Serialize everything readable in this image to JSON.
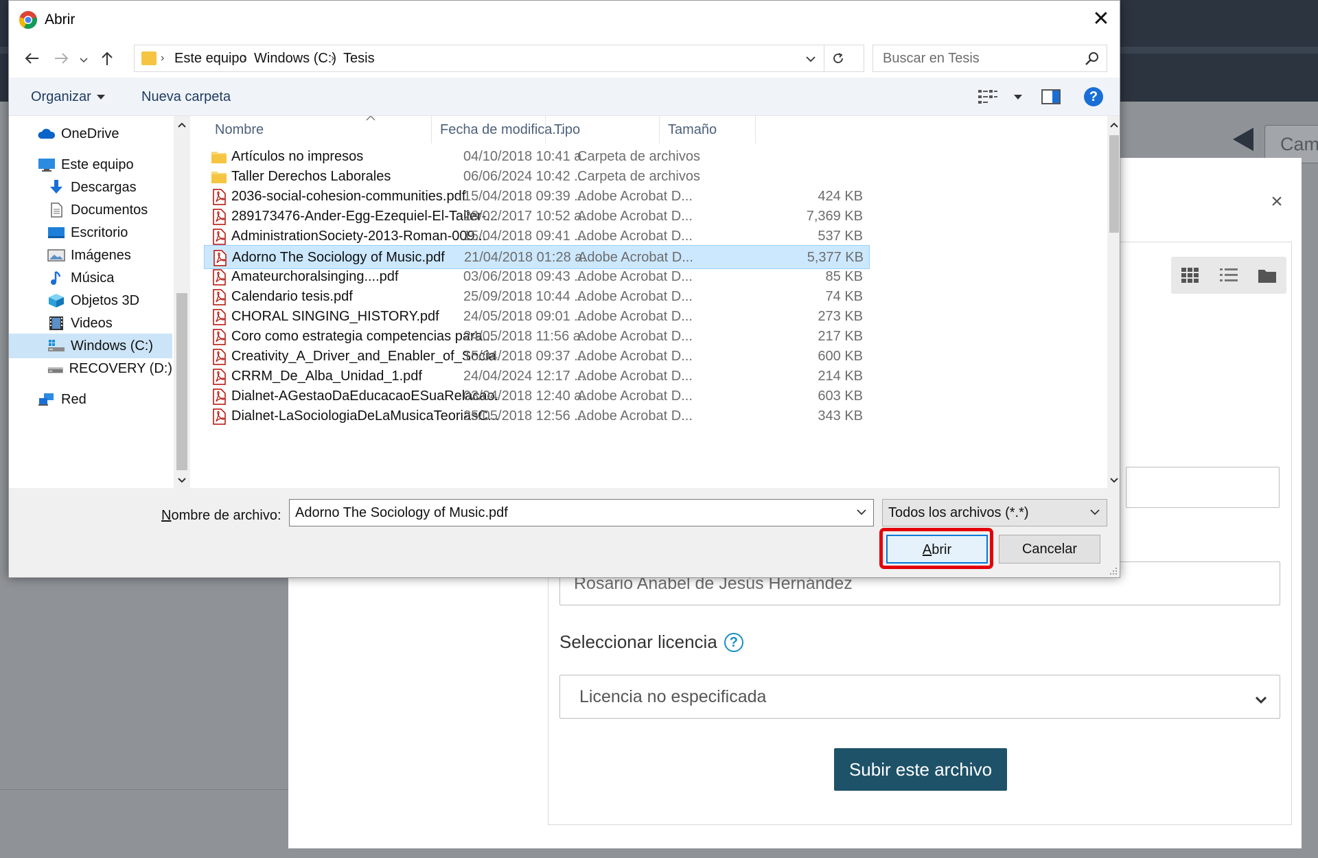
{
  "background": {
    "cam_button": "Cam",
    "close_symbol": "×",
    "author_value": "Rosario Anabel de Jesús Hernández",
    "license_label": "Seleccionar licencia",
    "license_value": "Licencia no especificada",
    "submit_label": "Subir este archivo"
  },
  "dialog": {
    "title": "Abrir",
    "close_symbol": "✕",
    "breadcrumb": [
      "Este equipo",
      "Windows (C:)",
      "Tesis"
    ],
    "search_placeholder": "Buscar en Tesis",
    "toolbar": {
      "organize": "Organizar",
      "new_folder": "Nueva carpeta"
    },
    "sidebar": [
      {
        "label": "OneDrive",
        "icon": "cloud-icon"
      },
      {
        "label": "Este equipo",
        "icon": "computer-icon"
      },
      {
        "label": "Descargas",
        "icon": "download-icon"
      },
      {
        "label": "Documentos",
        "icon": "document-icon"
      },
      {
        "label": "Escritorio",
        "icon": "desktop-icon"
      },
      {
        "label": "Imágenes",
        "icon": "image-icon"
      },
      {
        "label": "Música",
        "icon": "music-icon"
      },
      {
        "label": "Objetos 3D",
        "icon": "cube-icon"
      },
      {
        "label": "Videos",
        "icon": "video-icon"
      },
      {
        "label": "Windows (C:)",
        "icon": "drive-icon",
        "selected": true
      },
      {
        "label": "RECOVERY (D:)",
        "icon": "drive-icon"
      },
      {
        "label": "Red",
        "icon": "network-icon"
      }
    ],
    "columns": {
      "name": "Nombre",
      "date": "Fecha de modifica...",
      "type": "Tipo",
      "size": "Tamaño"
    },
    "files": [
      {
        "name": "Artículos no impresos",
        "date": "04/10/2018 10:41 a...",
        "type": "Carpeta de archivos",
        "size": "",
        "kind": "folder"
      },
      {
        "name": "Taller Derechos Laborales",
        "date": "06/06/2024 10:42 ...",
        "type": "Carpeta de archivos",
        "size": "",
        "kind": "folder"
      },
      {
        "name": "2036-social-cohesion-communities.pdf",
        "date": "15/04/2018 09:39 ...",
        "type": "Adobe Acrobat D...",
        "size": "424 KB",
        "kind": "pdf"
      },
      {
        "name": "289173476-Ander-Egg-Ezequiel-El-Taller-...",
        "date": "28/02/2017 10:52 a...",
        "type": "Adobe Acrobat D...",
        "size": "7,369 KB",
        "kind": "pdf"
      },
      {
        "name": "AdministrationSociety-2013-Roman-009...",
        "date": "15/04/2018 09:41 ...",
        "type": "Adobe Acrobat D...",
        "size": "537 KB",
        "kind": "pdf"
      },
      {
        "name": "Adorno The Sociology of Music.pdf",
        "date": "21/04/2018 01:28 a...",
        "type": "Adobe Acrobat D...",
        "size": "5,377 KB",
        "kind": "pdf",
        "selected": true
      },
      {
        "name": "Amateurchoralsinging....pdf",
        "date": "03/06/2018 09:43 ...",
        "type": "Adobe Acrobat D...",
        "size": "85 KB",
        "kind": "pdf"
      },
      {
        "name": "Calendario tesis.pdf",
        "date": "25/09/2018 10:44 ...",
        "type": "Adobe Acrobat D...",
        "size": "74 KB",
        "kind": "pdf"
      },
      {
        "name": "CHORAL SINGING_HISTORY.pdf",
        "date": "24/05/2018 09:01 ...",
        "type": "Adobe Acrobat D...",
        "size": "273 KB",
        "kind": "pdf"
      },
      {
        "name": "Coro como estrategia competencias para...",
        "date": "24/05/2018 11:56 a...",
        "type": "Adobe Acrobat D...",
        "size": "217 KB",
        "kind": "pdf"
      },
      {
        "name": "Creativity_A_Driver_and_Enabler_of_Socia...",
        "date": "15/04/2018 09:37 ...",
        "type": "Adobe Acrobat D...",
        "size": "600 KB",
        "kind": "pdf"
      },
      {
        "name": "CRRM_De_Alba_Unidad_1.pdf",
        "date": "24/04/2024 12:17 ...",
        "type": "Adobe Acrobat D...",
        "size": "214 KB",
        "kind": "pdf"
      },
      {
        "name": "Dialnet-AGestaoDaEducacaoESuaRelacao...",
        "date": "03/04/2018 12:40 a...",
        "type": "Adobe Acrobat D...",
        "size": "603 KB",
        "kind": "pdf"
      },
      {
        "name": "Dialnet-LaSociologiaDeLaMusicaTeoriasC...",
        "date": "25/05/2018 12:56 ...",
        "type": "Adobe Acrobat D...",
        "size": "343 KB",
        "kind": "pdf"
      }
    ],
    "filename_label_first": "N",
    "filename_label_rest": "ombre de archivo:",
    "filename_value": "Adorno The Sociology of Music.pdf",
    "filetype_value": "Todos los archivos (*.*)",
    "open_first": "A",
    "open_rest": "brir",
    "cancel_label": "Cancelar"
  },
  "colors": {
    "highlight": "#e3000b",
    "selection": "#cce8ff",
    "submit_bg": "#1e5268",
    "accent": "#0078d7"
  }
}
